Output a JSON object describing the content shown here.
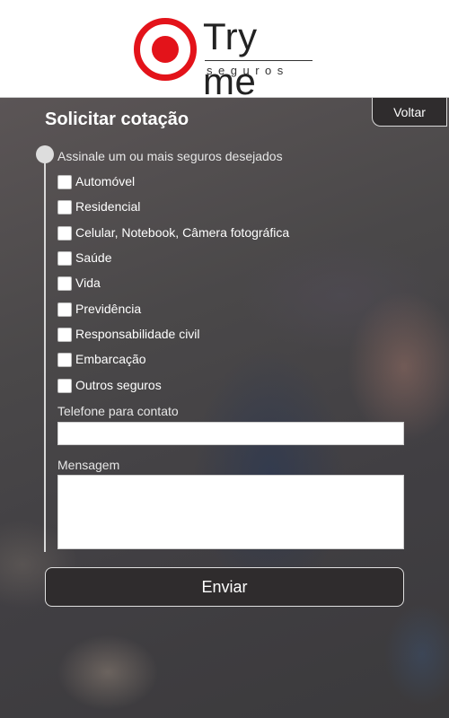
{
  "brand": {
    "name": "Try me",
    "sub": "seguros"
  },
  "nav": {
    "back_label": "Voltar"
  },
  "form": {
    "title": "Solicitar cotação",
    "instruction": "Assinale um ou mais seguros desejados",
    "options": [
      {
        "label": "Automóvel",
        "checked": false
      },
      {
        "label": "Residencial",
        "checked": false
      },
      {
        "label": "Celular, Notebook, Câmera fotográfica",
        "checked": false
      },
      {
        "label": "Saúde",
        "checked": false
      },
      {
        "label": "Vida",
        "checked": false
      },
      {
        "label": "Previdência",
        "checked": false
      },
      {
        "label": "Responsabilidade civil",
        "checked": false
      },
      {
        "label": "Embarcação",
        "checked": false
      },
      {
        "label": "Outros seguros",
        "checked": false
      }
    ],
    "phone": {
      "label": "Telefone para contato",
      "value": ""
    },
    "message": {
      "label": "Mensagem",
      "value": ""
    },
    "submit_label": "Enviar"
  },
  "colors": {
    "accent": "#e3131a",
    "panel": "#2f2c2d"
  }
}
